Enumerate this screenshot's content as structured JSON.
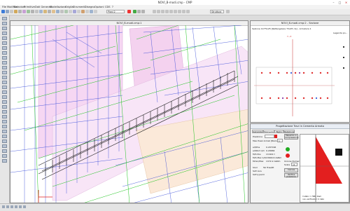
{
  "app": {
    "title": "NOVI_B-modi.cmp - CMP"
  },
  "menu": [
    "File",
    "Modifica",
    "Selezioni",
    "Primitive",
    "Dati Generali",
    "Modellazione",
    "Griglia",
    "Strumenti",
    "Disegno",
    "Opzioni",
    "CDS",
    "?"
  ],
  "toolbar": {
    "layer_value": "Piani 2",
    "color_value": "Struttura"
  },
  "view3d": {
    "title": "NOVI_B-modi.cmp:1"
  },
  "section_view": {
    "title": "NOVI_B-modi.cmp:2 - Sezione",
    "heading": "Sezione 19 F5x25 [Rettangolare Y5x25 cls] - Armatura 1",
    "legend_title": "Legenda po...",
    "axis_label": "Y~3"
  },
  "dialog": {
    "title": "Progettazione Travi in Cemento Armato",
    "tabs": [
      "Generale",
      "Momento",
      "Taglio",
      "Relazione"
    ],
    "posizione_label": "Posizione",
    "max_pos_label": "Max Posiz Armat (Momento)",
    "max_pos_value": "1",
    "stato_button": "Massimo in compressione",
    "fields": [
      {
        "label": "e/t/Pos",
        "value": "0.207196"
      },
      {
        "label": "e/t/Rot 1/2i",
        "value": "0.20684"
      },
      {
        "label": "M/S Pos",
        "value": "13.601 t"
      },
      {
        "label": "M/S Max 1/2i",
        "value": "13600.6 daNm"
      },
      {
        "label": "Mmin/Max",
        "value": "1372.2 daNm"
      }
    ],
    "options": [
      "Slod",
      "Tel Tras/Rt",
      "SLE rara",
      "SLE q.perm"
    ],
    "calc_button": "Calcola",
    "verify_button": "Verifica posizione",
    "scale_label": "Scala",
    "scale_value": "x1",
    "unione_label": "Unione Numerica",
    "diagram_notes": [
      "Y-stato = 7681 Dam",
      "non verificato = 0 dato"
    ]
  },
  "colors": {
    "mesh_blue": "#2a3fd6",
    "mesh_green": "#1ec41e",
    "pink_plane": "#f2c9ef",
    "beam_black": "#1b1b1b",
    "rebar_red": "#e03030",
    "rebar_blue": "#3060e0",
    "accent_red": "#e31f1f"
  },
  "icons": [
    "logo-icon",
    "save-icon",
    "undo-icon",
    "zoom-icon",
    "layer-icon",
    "color-icon",
    "close-icon",
    "minimize-icon",
    "maximize-icon"
  ]
}
